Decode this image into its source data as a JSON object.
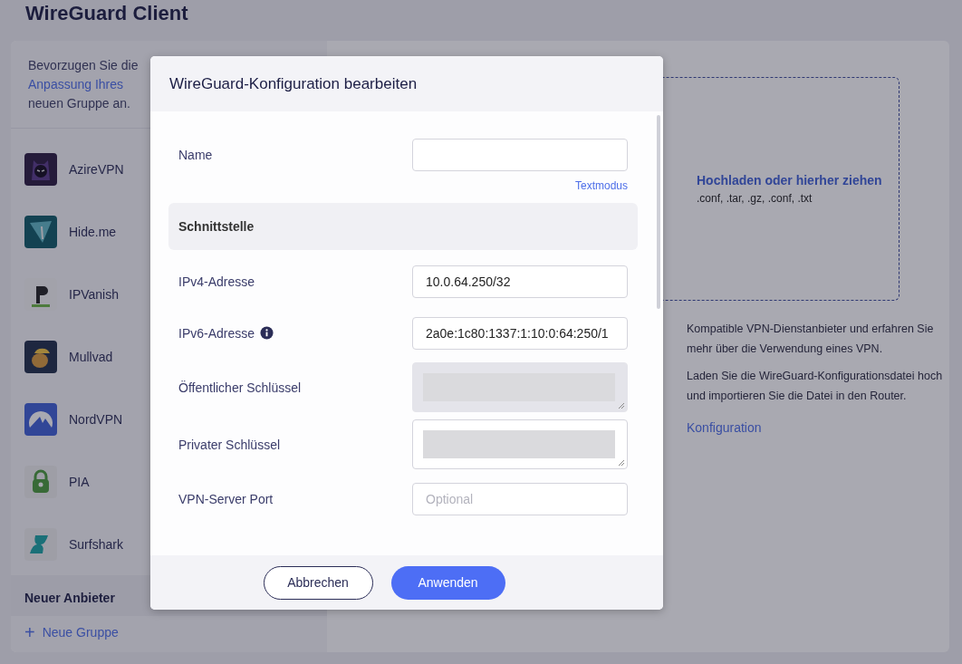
{
  "page": {
    "title": "WireGuard Client"
  },
  "sidebar": {
    "hint": {
      "before": "Bevorzugen Sie die",
      "link": "Anpassung Ihres",
      "after": "neuen Gruppe an."
    },
    "providers": [
      {
        "name": "AzireVPN",
        "kind": "azire"
      },
      {
        "name": "Hide.me",
        "kind": "hideme"
      },
      {
        "name": "IPVanish",
        "kind": "ipvanish"
      },
      {
        "name": "Mullvad",
        "kind": "mullvad"
      },
      {
        "name": "NordVPN",
        "kind": "nordvpn"
      },
      {
        "name": "PIA",
        "kind": "pia"
      },
      {
        "name": "Surfshark",
        "kind": "surfshark"
      }
    ],
    "section": "Neuer Anbieter",
    "add_group": {
      "icon": "+",
      "label": "Neue Gruppe"
    }
  },
  "upload": {
    "title": "Hochladen oder hierher ziehen",
    "formats": ".conf, .tar, .gz, .conf, .txt"
  },
  "info": [
    "Kompatible VPN-Dienstanbieter und erfahren Sie mehr über die Verwendung eines VPN.",
    "Laden Sie die WireGuard-Konfigurationsdatei hoch und importieren Sie die Datei in den Router."
  ],
  "config_link": "Konfiguration",
  "dialog": {
    "title": "WireGuard-Konfiguration bearbeiten",
    "rows": [
      {
        "kind": "field",
        "label": "Name",
        "value": "",
        "link": "Textmodus"
      },
      {
        "kind": "section",
        "label": "Schnittstelle"
      },
      {
        "kind": "field",
        "label": "IPv4-Adresse",
        "value": "10.0.64.250/32"
      },
      {
        "kind": "field",
        "label": "IPv6-Adresse",
        "value": "2a0e:1c80:1337:1:10:0:64:250/1",
        "info": true
      },
      {
        "kind": "textarea",
        "label": "Öffentlicher Schlüssel",
        "disabled": true,
        "redacted": true
      },
      {
        "kind": "textarea",
        "label": "Privater Schlüssel",
        "disabled": false,
        "redacted": true
      },
      {
        "kind": "field",
        "label": "VPN-Server Port",
        "placeholder": "Optional"
      }
    ],
    "buttons": {
      "cancel": "Abbrechen",
      "apply": "Anwenden"
    }
  }
}
